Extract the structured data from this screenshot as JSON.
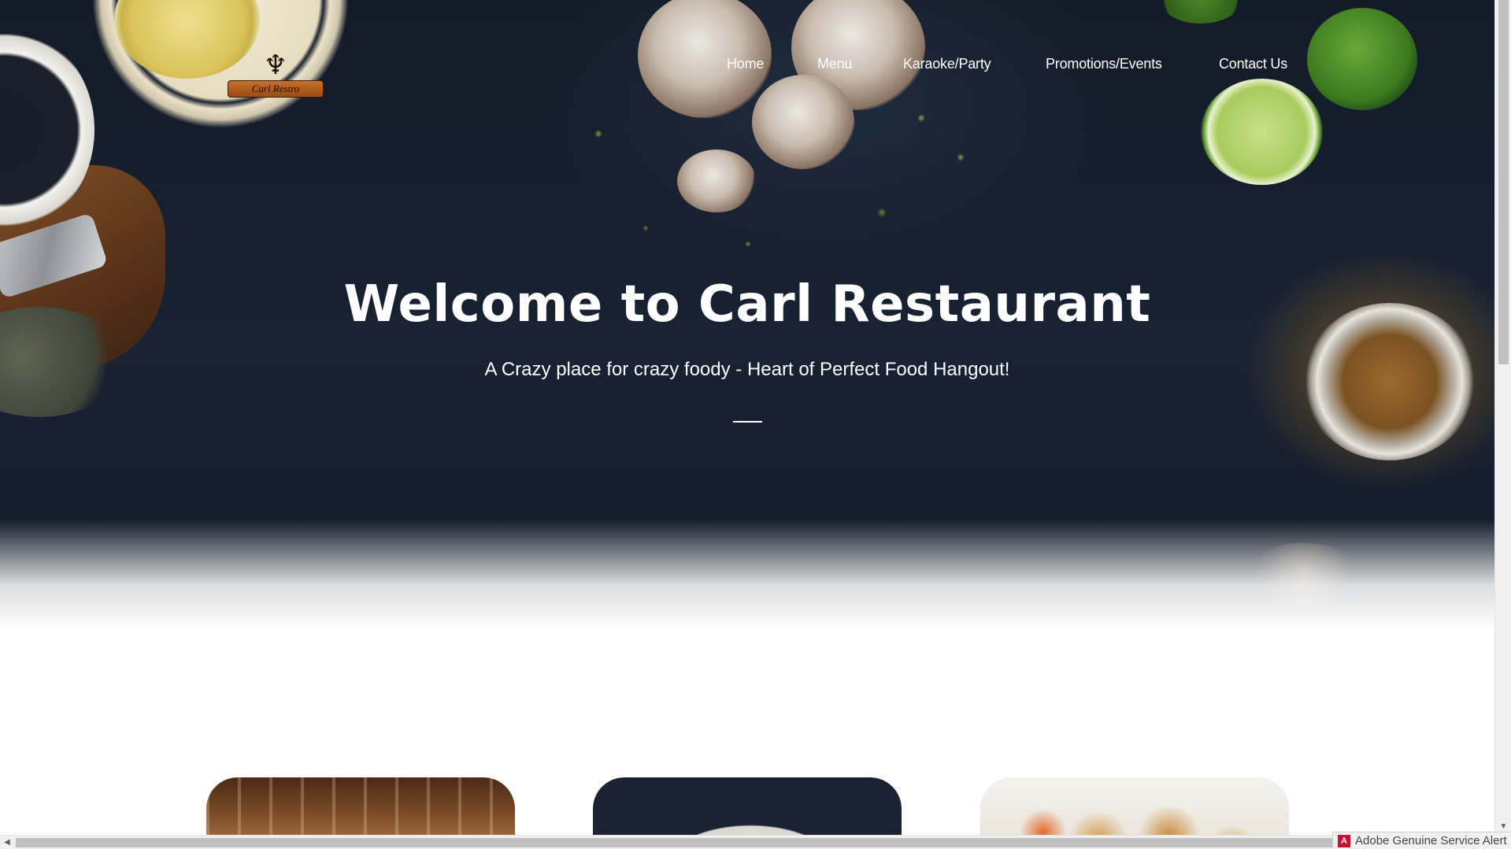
{
  "brand": {
    "logo_text": "Carl Restro",
    "logo_glyph": "♆"
  },
  "nav": {
    "items": [
      {
        "label": "Home"
      },
      {
        "label": "Menu"
      },
      {
        "label": "Karaoke/Party"
      },
      {
        "label": "Promotions/Events"
      },
      {
        "label": "Contact Us"
      }
    ]
  },
  "hero": {
    "title": "Welcome to Carl Restaurant",
    "subtitle": "A Crazy place for crazy foody - Heart of Perfect Food Hangout!"
  },
  "cards": [
    {
      "image": "restaurant-dining-room"
    },
    {
      "image": "plated-dish"
    },
    {
      "image": "fried-shrimp-platter"
    }
  ],
  "notification": {
    "text": "Adobe Genuine Service Alert",
    "icon": "adobe-icon"
  },
  "scrollbars": {
    "down_arrow": "▼",
    "left_arrow": "◀"
  },
  "colors": {
    "hero_background": "#131b27",
    "text": "#ffffff",
    "accent_spice": "#c4801a",
    "adobe_red": "#c8102e"
  }
}
